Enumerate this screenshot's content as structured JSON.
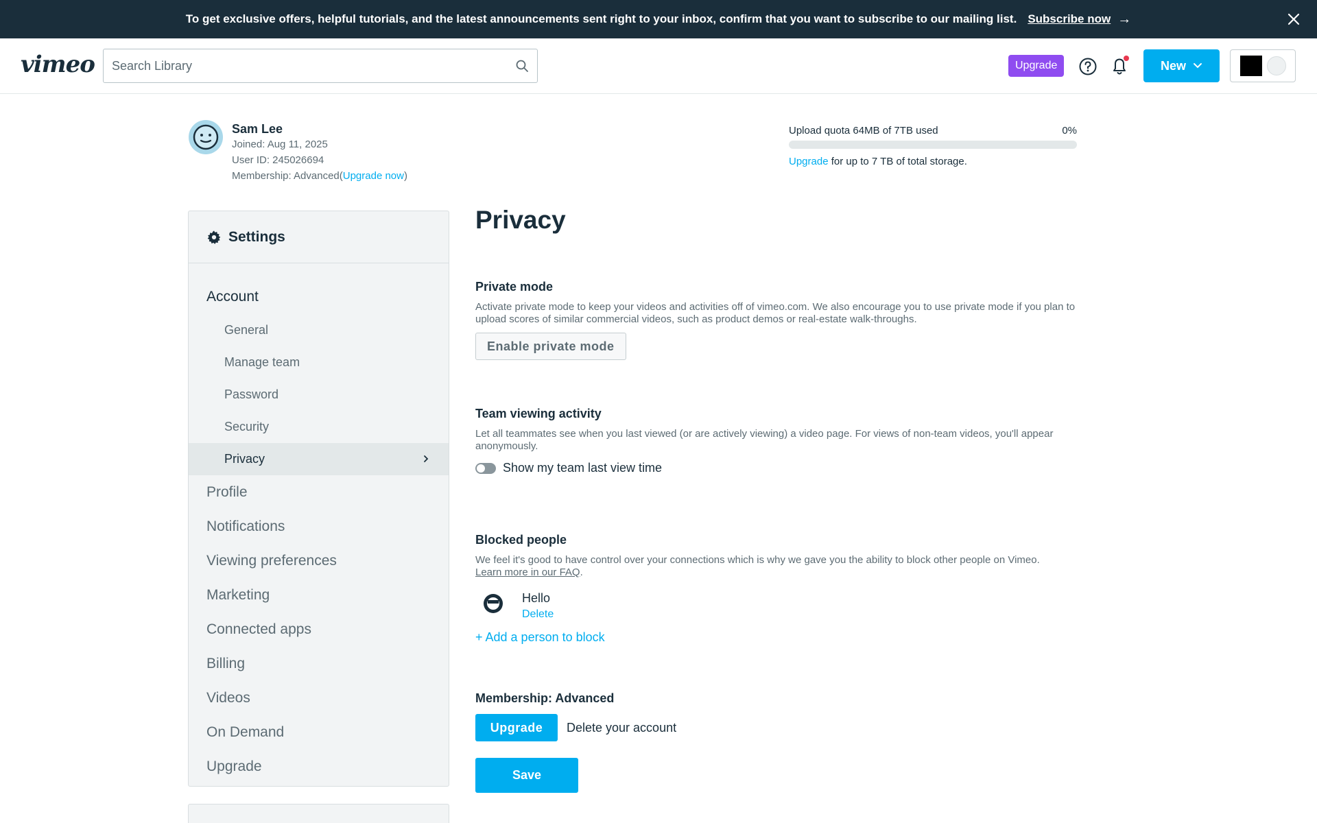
{
  "banner": {
    "message": "To get exclusive offers, helpful tutorials, and the latest announcements sent right to your inbox, confirm that you want to subscribe to our mailing list.",
    "link": "Subscribe now",
    "arrow": "→"
  },
  "header": {
    "logo": "vimeo",
    "search_placeholder": "Search Library",
    "upgrade_label": "Upgrade",
    "new_label": "New"
  },
  "user": {
    "name": "Sam Lee",
    "joined": "Joined: Aug 11, 2025",
    "user_id": "User ID: 245026694",
    "membership_prefix": "Membership: Advanced(",
    "membership_link": "Upgrade now",
    "membership_suffix": ")"
  },
  "quota": {
    "label": "Upload quota 64MB of 7TB used",
    "percent": "0%",
    "fill_fraction": 0.0,
    "upgrade_link": "Upgrade",
    "upgrade_note": " for up to 7 TB of total storage."
  },
  "sidebar": {
    "title": "Settings",
    "account": "Account",
    "sub_items": [
      "General",
      "Manage team",
      "Password",
      "Security",
      "Privacy"
    ],
    "active_item": "Privacy",
    "items": [
      "Profile",
      "Notifications",
      "Viewing preferences",
      "Marketing",
      "Connected apps",
      "Billing",
      "Videos",
      "On Demand",
      "Upgrade"
    ]
  },
  "main": {
    "heading": "Privacy",
    "private_mode": {
      "title": "Private mode",
      "description": "Activate private mode to keep your videos and activities off of vimeo.com. We also encourage you to use private mode if you plan to upload scores of similar commercial videos, such as product demos or real-estate walk-throughs.",
      "button": "Enable private mode"
    },
    "team_viewing": {
      "title": "Team viewing activity",
      "description": "Let all teammates see when you last viewed (or are actively viewing) a video page. For views of non-team videos, you'll appear anonymously.",
      "toggle_label": "Show my team last view time",
      "toggle_on": false
    },
    "blocked": {
      "title": "Blocked people",
      "description": "We feel it's good to have control over your connections which is why we gave you the ability to block other people on Vimeo.",
      "faq_link": "Learn more in our FAQ",
      "faq_suffix": ".",
      "person_name": "Hello",
      "delete_label": "Delete",
      "add_label": "+ Add a person to block"
    },
    "membership": {
      "title": "Membership: Advanced",
      "upgrade_button": "Upgrade",
      "delete_account": "Delete your account"
    },
    "save_button": "Save"
  },
  "colors": {
    "brand_blue": "#00adef",
    "banner_bg": "#1a2e3b",
    "upgrade_purple": "#8f4cf0",
    "notification_dot": "#e8384f"
  }
}
